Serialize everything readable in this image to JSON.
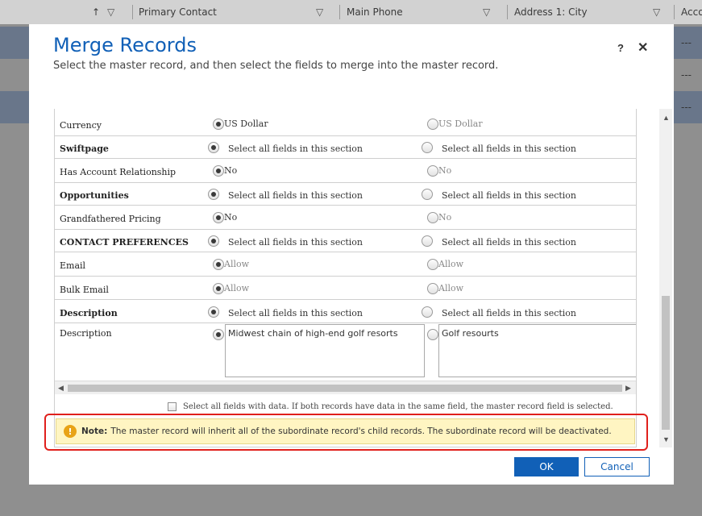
{
  "background": {
    "columns": [
      {
        "label": "Primary Contact"
      },
      {
        "label": "Main Phone"
      },
      {
        "label": "Address 1: City"
      },
      {
        "label": "Acco"
      }
    ],
    "sort_icon": "arrow-up-icon",
    "filter_icon": "filter-icon",
    "row_values": [
      "---",
      "---",
      "---"
    ]
  },
  "dialog": {
    "title": "Merge Records",
    "subtitle": "Select the master record, and then select the fields to merge into the master record.",
    "help_label": "?",
    "close_label": "✕"
  },
  "form": {
    "rows": [
      {
        "label": "Currency",
        "section": false,
        "master": "US Dollar",
        "other": "US Dollar",
        "selected": "master"
      },
      {
        "label": "Swiftpage",
        "section": true,
        "master": "Select all fields in this section",
        "other": "Select all fields in this section",
        "selected": "master"
      },
      {
        "label": "Has Account Relationship",
        "section": false,
        "master": "No",
        "other": "No",
        "selected": "master"
      },
      {
        "label": "Opportunities",
        "section": true,
        "master": "Select all fields in this section",
        "other": "Select all fields in this section",
        "selected": "master"
      },
      {
        "label": "Grandfathered Pricing",
        "section": false,
        "master": "No",
        "other": "No",
        "selected": "master"
      },
      {
        "label": "CONTACT PREFERENCES",
        "section": true,
        "master": "Select all fields in this section",
        "other": "Select all fields in this section",
        "selected": "master"
      },
      {
        "label": "Email",
        "section": false,
        "master": "Allow",
        "other": "Allow",
        "selected": "master"
      },
      {
        "label": "Bulk Email",
        "section": false,
        "master": "Allow",
        "other": "Allow",
        "selected": "master"
      },
      {
        "label": "Description",
        "section": true,
        "master": "Select all fields in this section",
        "other": "Select all fields in this section",
        "selected": "master"
      },
      {
        "label": "Description",
        "section": false,
        "master": "Midwest chain of high-end golf resorts",
        "other": "Golf resourts",
        "selected": "master"
      }
    ],
    "select_all_label": "Select all fields with data. If both records have data in the same field, the master record field is selected."
  },
  "note": {
    "prefix": "Note:",
    "text": "The master record will inherit all of the subordinate record's child records. The subordinate record will be deactivated.",
    "icon": "warning-icon",
    "icon_glyph": "!"
  },
  "buttons": {
    "ok": "OK",
    "cancel": "Cancel"
  }
}
